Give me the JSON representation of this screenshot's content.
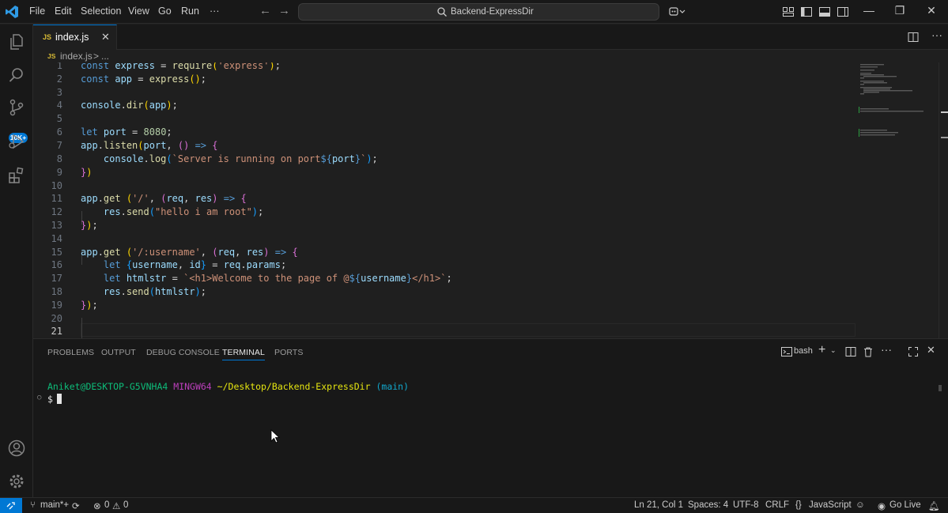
{
  "menu": [
    "File",
    "Edit",
    "Selection",
    "View",
    "Go",
    "Run",
    "···"
  ],
  "search": {
    "text": "Backend-ExpressDir"
  },
  "activity": {
    "items": [
      "explorer-icon",
      "search-icon",
      "source-control-icon",
      "run-debug-icon",
      "extensions-icon"
    ],
    "badge": "10K+",
    "bottom": [
      "account-icon",
      "settings-gear-icon"
    ]
  },
  "tab": {
    "lang": "JS",
    "name": "index.js",
    "close": "✕"
  },
  "breadcrumb": {
    "lang": "JS",
    "file": "index.js",
    "sep": ">",
    "more": "..."
  },
  "editor": {
    "line_numbers": [
      "1",
      "2",
      "3",
      "4",
      "5",
      "6",
      "7",
      "8",
      "9",
      "10",
      "11",
      "12",
      "13",
      "14",
      "15",
      "16",
      "17",
      "18",
      "19",
      "20",
      "21"
    ],
    "active_line": "21"
  },
  "panel": {
    "tabs": [
      "PROBLEMS",
      "OUTPUT",
      "DEBUG CONSOLE",
      "TERMINAL",
      "PORTS"
    ],
    "active_tab": "TERMINAL",
    "shell": "bash"
  },
  "terminal": {
    "user": "Aniket@DESKTOP-G5VNHA4",
    "env": "MINGW64",
    "path": "~/Desktop/Backend-ExpressDir",
    "branch": "(main)",
    "prompt": "$"
  },
  "status": {
    "branch": "main*+",
    "errors": "0",
    "warnings": "0",
    "position": "Ln 21, Col 1",
    "spaces": "Spaces: 4",
    "encoding": "UTF-8",
    "eol": "CRLF",
    "language": "JavaScript",
    "golive": "Go Live"
  },
  "colors": {
    "accent": "#0078d4",
    "bg": "#1f1f1f",
    "chrome": "#181818"
  }
}
